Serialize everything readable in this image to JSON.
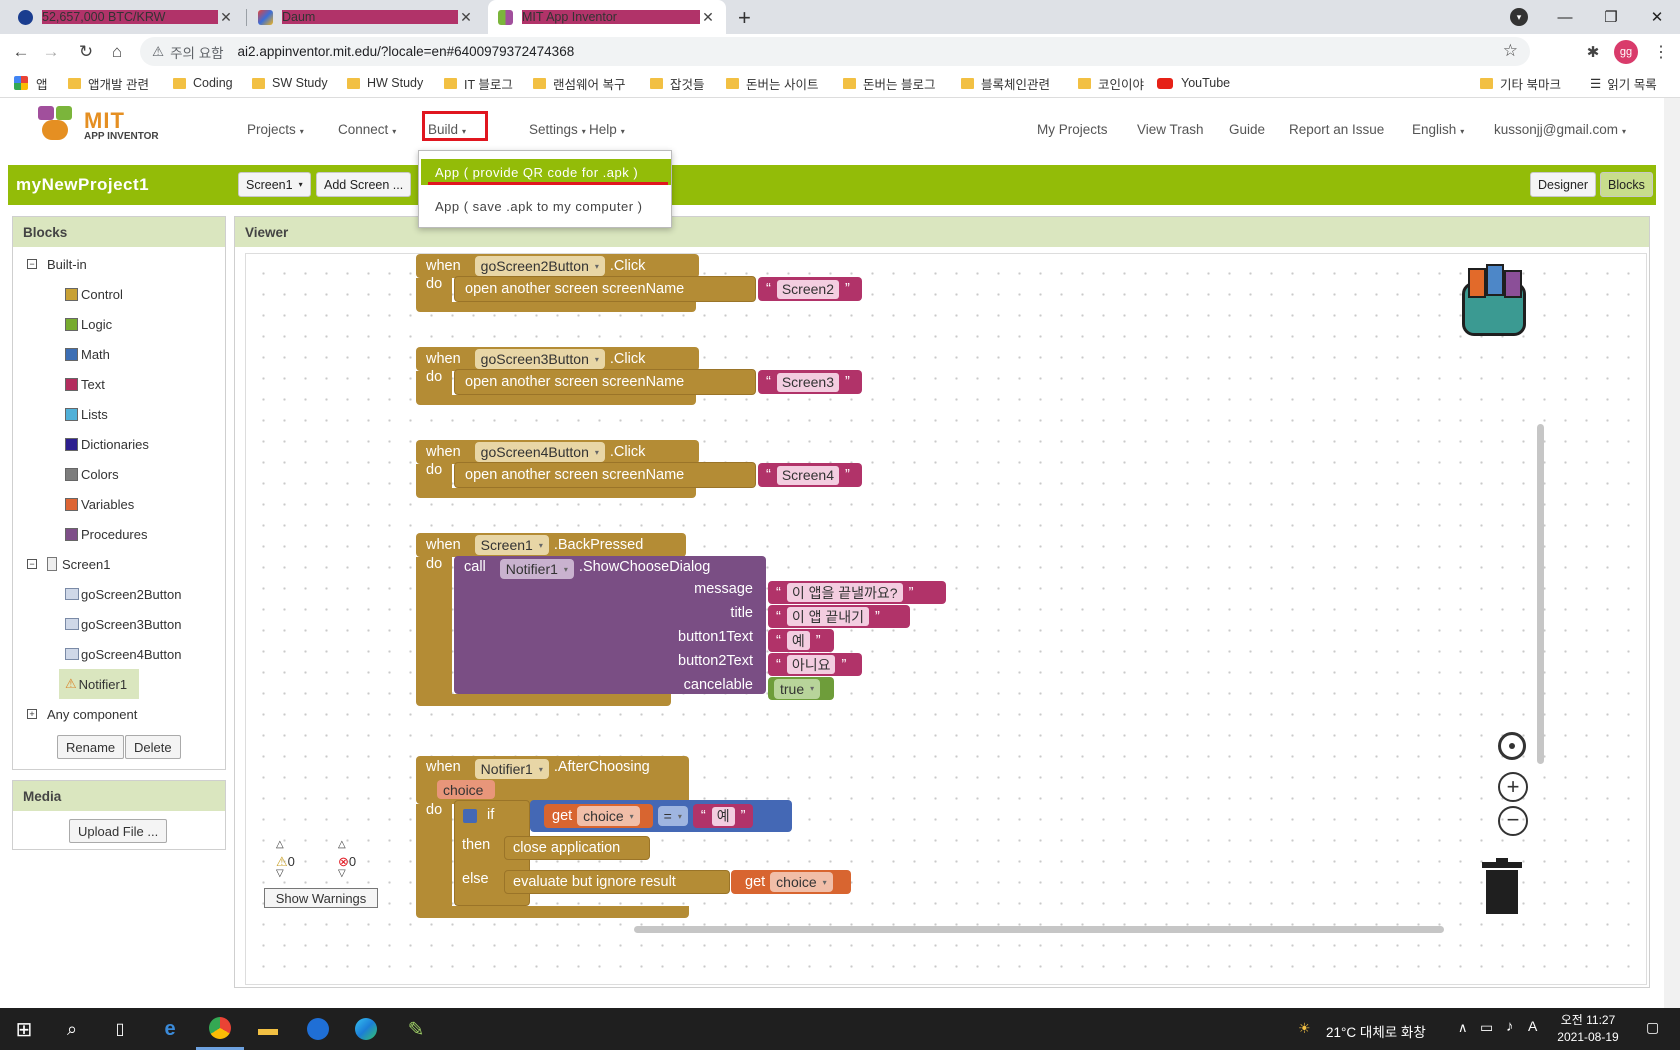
{
  "browser": {
    "tabs": [
      {
        "title": "52,657,000 BTC/KRW",
        "favicon_color": "#1a3d8f"
      },
      {
        "title": "Daum",
        "favicon_color": "#e5433a"
      },
      {
        "title": "MIT App Inventor",
        "favicon_color": "#7bb53b"
      }
    ],
    "new_tab_icon": "plus-icon",
    "security_warning": "주의 요함",
    "url": "ai2.appinventor.mit.edu/?locale=en#6400979372474368",
    "profile_initials": "gg",
    "bookmarks": [
      "앱",
      "앱개발 관련",
      "Coding",
      "SW Study",
      "HW Study",
      "IT 블로그",
      "랜섬웨어 복구",
      "잡것들",
      "돈버는 사이트",
      "돈버는 블로그",
      "블록체인관련",
      "코인이야",
      "YouTube"
    ],
    "other_bookmarks": "기타 북마크",
    "reading_list": "읽기 목록"
  },
  "app": {
    "logo_main": "MIT",
    "logo_sub": "APP INVENTOR",
    "nav_left": [
      "Projects",
      "Connect",
      "Build",
      "Settings",
      "Help"
    ],
    "nav_right": [
      "My Projects",
      "View Trash",
      "Guide",
      "Report an Issue",
      "English",
      "kussonjj@gmail.com"
    ],
    "project_name": "myNewProject1",
    "screen_select": "Screen1",
    "add_screen": "Add Screen ...",
    "designer_btn": "Designer",
    "blocks_btn": "Blocks",
    "build_menu": [
      "App ( provide QR code for .apk )",
      "App ( save .apk to my computer )"
    ]
  },
  "blocks_panel": {
    "title": "Blocks",
    "builtin_label": "Built-in",
    "builtin": [
      {
        "label": "Control",
        "color": "#c8a135"
      },
      {
        "label": "Logic",
        "color": "#77ab2f"
      },
      {
        "label": "Math",
        "color": "#3c6eb4"
      },
      {
        "label": "Text",
        "color": "#b32d5e"
      },
      {
        "label": "Lists",
        "color": "#50b0d8"
      },
      {
        "label": "Dictionaries",
        "color": "#2d1f8f"
      },
      {
        "label": "Colors",
        "color": "#7d7d7d"
      },
      {
        "label": "Variables",
        "color": "#dd6534"
      },
      {
        "label": "Procedures",
        "color": "#7e4f88"
      }
    ],
    "screen_label": "Screen1",
    "components": [
      "goScreen2Button",
      "goScreen3Button",
      "goScreen4Button",
      "Notifier1"
    ],
    "any_component": "Any component",
    "rename": "Rename",
    "delete": "Delete"
  },
  "media_panel": {
    "title": "Media",
    "upload": "Upload File ..."
  },
  "viewer": {
    "title": "Viewer",
    "warn_count": "0",
    "error_count": "0",
    "show_warnings": "Show Warnings",
    "blocks": [
      {
        "when": "when",
        "component": "goScreen2Button",
        "event": ".Click",
        "do": "do",
        "open": "open another screen screenName",
        "screen": "Screen2"
      },
      {
        "when": "when",
        "component": "goScreen3Button",
        "event": ".Click",
        "do": "do",
        "open": "open another screen screenName",
        "screen": "Screen3"
      },
      {
        "when": "when",
        "component": "goScreen4Button",
        "event": ".Click",
        "do": "do",
        "open": "open another screen screenName",
        "screen": "Screen4"
      }
    ],
    "back": {
      "when": "when",
      "component": "Screen1",
      "event": ".BackPressed",
      "do": "do",
      "call": "call",
      "notifier": "Notifier1",
      "method": ".ShowChooseDialog",
      "params": [
        "message",
        "title",
        "button1Text",
        "button2Text",
        "cancelable"
      ],
      "message": "이 앱을 끝낼까요?",
      "title": "이 앱 끝내기",
      "button1": "예",
      "button2": "아니요",
      "cancelable": "true"
    },
    "after": {
      "when": "when",
      "component": "Notifier1",
      "event": ".AfterChoosing",
      "param": "choice",
      "do": "do",
      "if": "if",
      "get": "get",
      "var": "choice",
      "op": "=",
      "value": "예",
      "then": "then",
      "close": "close application",
      "else": "else",
      "evaluate": "evaluate but ignore result",
      "get2": "get",
      "var2": "choice"
    }
  },
  "taskbar": {
    "weather": "21°C 대체로 화창",
    "time": "오전 11:27",
    "date": "2021-08-19"
  }
}
